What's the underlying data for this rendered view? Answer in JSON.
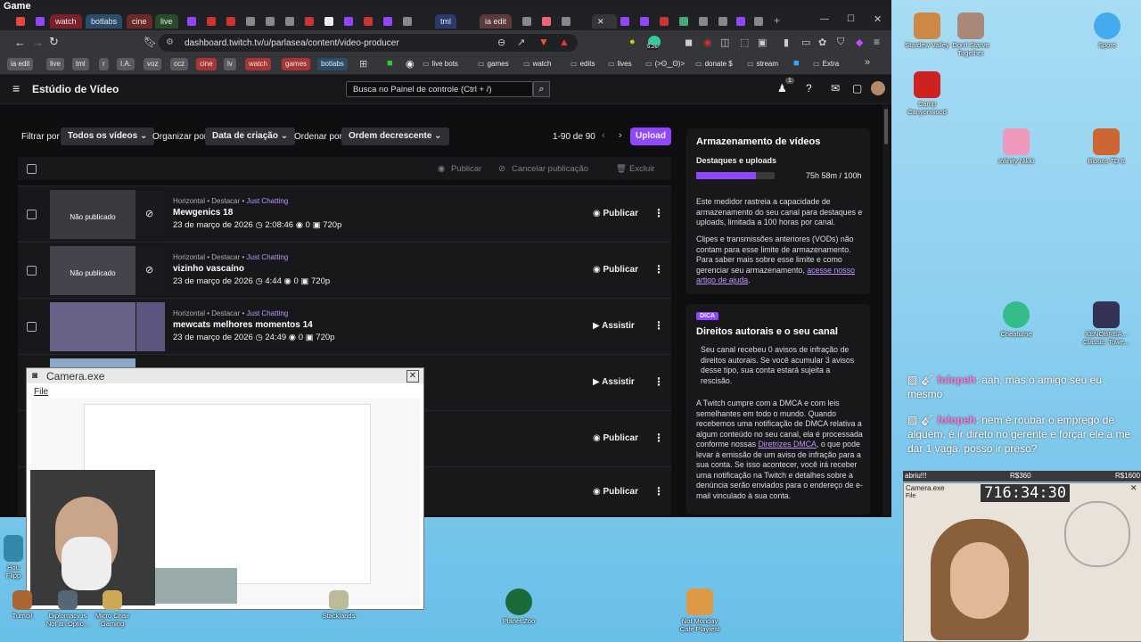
{
  "window": {
    "title": "Game"
  },
  "tabs": [
    {
      "label": "watch"
    },
    {
      "label": "botlabs"
    },
    {
      "label": "cine"
    },
    {
      "label": "live"
    },
    {
      "label": "tml"
    },
    {
      "label": "ia edit"
    }
  ],
  "browser": {
    "url": "dashboard.twitch.tv/u/parlasea/content/video-producer",
    "badge": "5.26"
  },
  "bookmarks": [
    {
      "label": "ia edit",
      "kind": "tag"
    },
    {
      "label": "live",
      "kind": "tag"
    },
    {
      "label": "tml",
      "kind": "tag"
    },
    {
      "label": "r",
      "kind": "tag"
    },
    {
      "label": "I.A.",
      "kind": "tag"
    },
    {
      "label": "voz",
      "kind": "tag"
    },
    {
      "label": "ccz",
      "kind": "tag"
    },
    {
      "label": "cine",
      "kind": "tag"
    },
    {
      "label": "lv",
      "kind": "tag"
    },
    {
      "label": "watch",
      "kind": "tag"
    },
    {
      "label": "games",
      "kind": "tag"
    },
    {
      "label": "botlabs",
      "kind": "tag"
    },
    {
      "label": "live bots",
      "kind": "folder"
    },
    {
      "label": "games",
      "kind": "folder"
    },
    {
      "label": "watch",
      "kind": "folder"
    },
    {
      "label": "edits",
      "kind": "folder"
    },
    {
      "label": "lives",
      "kind": "folder"
    },
    {
      "label": "(>ʘ‿ʘ)>",
      "kind": "folder"
    },
    {
      "label": "donate $",
      "kind": "folder"
    },
    {
      "label": "stream",
      "kind": "folder"
    },
    {
      "label": "Extra",
      "kind": "folder"
    }
  ],
  "header": {
    "title": "Estúdio de Vídeo",
    "search_placeholder": "Busca no Painel de controle (Ctrl + /)",
    "notification_count": "1"
  },
  "filters": {
    "filter_label": "Filtrar por",
    "filter_value": "Todos os vídeos",
    "organize_label": "Organizar por",
    "organize_value": "Data de criação",
    "order_label": "Ordenar por",
    "order_value": "Ordem decrescente",
    "count": "1-90 de 90",
    "upload_label": "Upload"
  },
  "table_actions": {
    "publish": "Publicar",
    "cancel": "Cancelar publicação",
    "delete": "Excluir"
  },
  "videos": [
    {
      "meta": "Horizontal • Destacar • ",
      "category": "Just Chatting",
      "title": "Mewgenics 18",
      "date": "23 de março de 2026",
      "duration": "2:08:46",
      "views": "0",
      "quality": "720p",
      "status": "Não publicado",
      "action": "Publicar"
    },
    {
      "meta": "Horizontal • Destacar • ",
      "category": "Just Chatting",
      "title": "vizinho vascaíno",
      "date": "23 de março de 2026",
      "duration": "4:44",
      "views": "0",
      "quality": "720p",
      "status": "Não publicado",
      "action": "Publicar"
    },
    {
      "meta": "Horizontal • Destacar • ",
      "category": "Just Chatting",
      "title": "mewcats melhores momentos 14",
      "date": "23 de março de 2026",
      "duration": "24:49",
      "views": "0",
      "quality": "720p",
      "status": "",
      "action": "Assistir"
    },
    {
      "action": "Assistir"
    },
    {
      "action": "Publicar"
    },
    {
      "action": "Publicar"
    }
  ],
  "storage": {
    "title": "Armazenamento de vídeos",
    "subtitle": "Destaques e uploads",
    "usage": "75h 58m / 100h",
    "fill_fraction": 0.76,
    "p1": "Este medidor rastreia a capacidade de armazenamento do seu canal para destaques e uploads, limitada a 100 horas por canal.",
    "p2": "Clipes e transmissões anteriores (VODs) não contam para esse limite de armazenamento. Para saber mais sobre esse limite e como gerenciar seu armazenamento, ",
    "p2_link": "acesse nosso artigo de ajuda",
    "p2_end": "."
  },
  "copyright": {
    "badge": "DICA",
    "title": "Direitos autorais e o seu canal",
    "p1": "Seu canal recebeu 0 avisos de infração de direitos autorais. Se você acumular 3 avisos desse tipo, sua conta estará sujeita a rescisão.",
    "p2": "A Twitch cumpre com a DMCA e com leis semelhantes em todo o mundo. Quando recebemos uma notificação de DMCA relativa a algum conteúdo no seu canal, ela é processada conforme nossas ",
    "p2_link": "Diretrizes DMCA",
    "p2_end": ", o que pode levar à emissão de um aviso de infração para a sua conta. Se isso acontecer, você irá receber uma notificação na Twitch e detalhes sobre a denúncia serão enviados para o endereço de e-mail vinculado à sua conta."
  },
  "camera_window": {
    "title": "Camera.exe",
    "menu": "File"
  },
  "chat": [
    {
      "user": "folopeh",
      "text": ": aah, mas o amigo seu eu mesmo"
    },
    {
      "user": "folopeh",
      "text": ": nem é roubar o emprego de alguém, é ir direto no gerente e forçar ele a me dar 1 vaga. posso ir preso?"
    }
  ],
  "overlay": {
    "abriu": "abriu!!!",
    "r360": "R$360",
    "r1600": "R$1600",
    "cam_title": "Camera.exe",
    "cam_menu": "File",
    "timer": "716:34:30"
  },
  "desktop_icons": [
    {
      "label": "Stardew Valley"
    },
    {
      "label": "Don't Starve Together"
    },
    {
      "label": "Spore"
    },
    {
      "label": "Camp Canyonwood"
    },
    {
      "label": "Infinity Nikki"
    },
    {
      "label": "Bloons TD 6"
    },
    {
      "label": "Cheaturne"
    },
    {
      "label": "XENOBREA... Classic: Towe..."
    },
    {
      "label": "Hou Flipp"
    },
    {
      "label": "Turnoil"
    },
    {
      "label": "Diplomacy is Not an Optio..."
    },
    {
      "label": "Micro Chair Gaming"
    },
    {
      "label": "Stacklands"
    },
    {
      "label": "Planet Zoo"
    },
    {
      "label": "Not Monday Cafe Playtest"
    }
  ]
}
